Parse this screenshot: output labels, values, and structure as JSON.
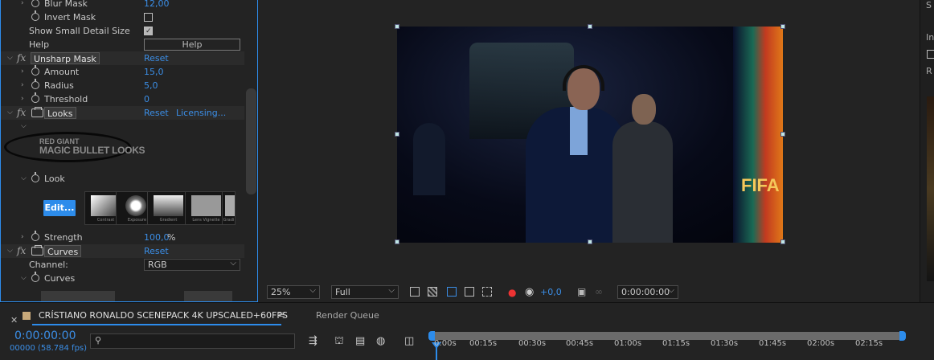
{
  "effects": {
    "blur_mask": {
      "label": "Blur Mask",
      "value": "12,00"
    },
    "invert_mask": {
      "label": "Invert Mask",
      "checked": false
    },
    "small_detail": {
      "label": "Show Small Detail Size",
      "checked": true
    },
    "help": {
      "label": "Help",
      "button": "Help"
    },
    "unsharp": {
      "name": "Unsharp Mask",
      "reset": "Reset",
      "amount_label": "Amount",
      "amount": "15,0",
      "radius_label": "Radius",
      "radius": "5,0",
      "threshold_label": "Threshold",
      "threshold": "0"
    },
    "looks": {
      "name": "Looks",
      "reset": "Reset",
      "licensing": "Licensing...",
      "logo_line1": "RED GIANT",
      "logo_line2": "MAGIC BULLET LOOKS",
      "look_label": "Look",
      "edit": "Edit...",
      "thumbs": [
        "Contrast",
        "Exposure",
        "Gradient",
        "Lens Vignette",
        "Gradi"
      ],
      "strength_label": "Strength",
      "strength": "100,0",
      "strength_unit": "%"
    },
    "curves": {
      "name": "Curves",
      "reset": "Reset",
      "channel_label": "Channel:",
      "channel": "RGB",
      "curves_label": "Curves"
    }
  },
  "viewer": {
    "zoom": "25%",
    "resolution": "Full",
    "exposure": "+0,0",
    "timecode": "0:00:00:00",
    "video_text": "FIFA"
  },
  "timeline": {
    "comp_name": "CRÍSTIANO RONALDO SCENEPACK 4K UPSCALED+60FPS",
    "render_queue": "Render Queue",
    "timecode": "0:00:00:00",
    "frames": "00000 (58.784 fps)",
    "search_placeholder": "",
    "ticks": [
      "0:00s",
      "00:15s",
      "00:30s",
      "00:45s",
      "01:00s",
      "01:15s",
      "01:30s",
      "01:45s",
      "02:00s",
      "02:15s"
    ]
  },
  "right_panel": {
    "s": "S",
    "i": "In",
    "r": "R"
  },
  "colors": {
    "accent": "#2d8ceb",
    "value_blue": "#3b8ee6"
  }
}
